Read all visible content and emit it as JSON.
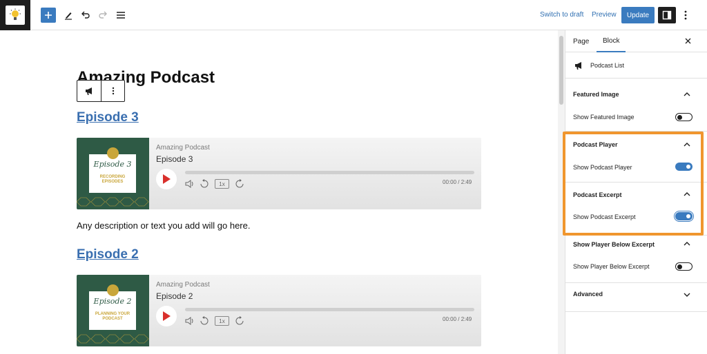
{
  "toolbar": {
    "switch_to_draft": "Switch to draft",
    "preview": "Preview",
    "update": "Update",
    "icons": [
      "add-block-icon",
      "pencil-tool-icon",
      "undo-icon",
      "redo-icon",
      "list-view-icon",
      "sidebar-icon",
      "more-options-icon"
    ]
  },
  "editor": {
    "page_title": "Amazing Podcast",
    "episodes": [
      {
        "title": "Episode 3",
        "show_name": "Amazing Podcast",
        "player_title": "Episode 3",
        "cover_script": "Episode 3",
        "cover_subtitle": "RECORDING EPISODES",
        "speed": "1x",
        "time": "00:00 / 2:49"
      },
      {
        "title": "Episode 2",
        "show_name": "Amazing Podcast",
        "player_title": "Episode 2",
        "cover_script": "Episode 2",
        "cover_subtitle": "PLANNING YOUR PODCAST",
        "speed": "1x",
        "time": "00:00 / 2:49"
      }
    ],
    "description": "Any description or text you add will go here."
  },
  "sidebar": {
    "tabs": [
      "Page",
      "Block"
    ],
    "active_tab": "Block",
    "block_name": "Podcast List",
    "panels": [
      {
        "heading": "Featured Image",
        "row": "Show Featured Image",
        "enabled": false
      },
      {
        "heading": "Podcast Player",
        "row": "Show Podcast Player",
        "enabled": true
      },
      {
        "heading": "Podcast Excerpt",
        "row": "Show Podcast Excerpt",
        "enabled": true
      },
      {
        "heading": "Show Player Below Excerpt",
        "row": "Show Player Below Excerpt",
        "enabled": false
      },
      {
        "heading": "Advanced"
      }
    ]
  },
  "colors": {
    "accent": "#3a7bbf",
    "highlight": "#f0962e",
    "link": "#3a6fb0",
    "cover_green": "#2e5a45",
    "cover_gold": "#c9a63a",
    "play_red": "#d9302c"
  }
}
